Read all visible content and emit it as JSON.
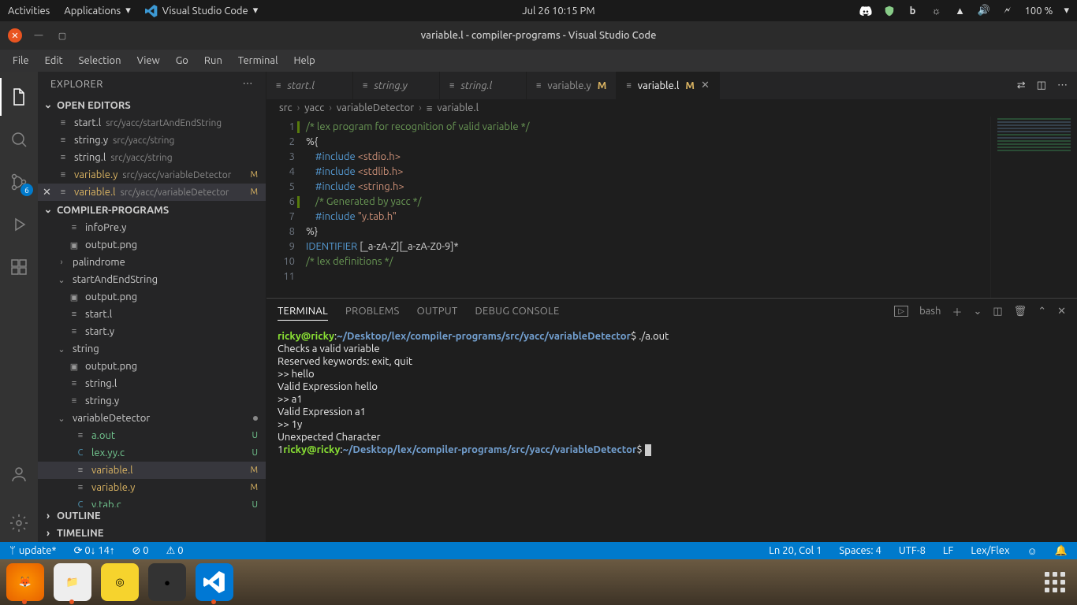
{
  "gnome": {
    "activities": "Activities",
    "applications": "Applications",
    "app_label": "Visual Studio Code",
    "datetime": "Jul 26  10:15 PM",
    "battery": "100 %"
  },
  "window": {
    "title": "variable.l - compiler-programs - Visual Studio Code"
  },
  "menubar": [
    "File",
    "Edit",
    "Selection",
    "View",
    "Go",
    "Run",
    "Terminal",
    "Help"
  ],
  "sidebar": {
    "title": "EXPLORER",
    "open_editors": "OPEN EDITORS",
    "project": "COMPILER-PROGRAMS",
    "outline": "OUTLINE",
    "timeline": "TIMELINE",
    "editors": [
      {
        "name": "start.l",
        "path": "src/yacc/startAndEndString",
        "mod": ""
      },
      {
        "name": "string.y",
        "path": "src/yacc/string",
        "mod": ""
      },
      {
        "name": "string.l",
        "path": "src/yacc/string",
        "mod": ""
      },
      {
        "name": "variable.y",
        "path": "src/yacc/variableDetector",
        "mod": "M"
      },
      {
        "name": "variable.l",
        "path": "src/yacc/variableDetector",
        "mod": "M",
        "active": true
      }
    ],
    "files": [
      {
        "name": "infoPre.y",
        "ind": 2,
        "ic": "≡"
      },
      {
        "name": "output.png",
        "ind": 2,
        "ic": "▣"
      },
      {
        "name": "palindrome",
        "ind": 1,
        "ic": "›",
        "folder": true
      },
      {
        "name": "startAndEndString",
        "ind": 1,
        "ic": "⌄",
        "folder": true
      },
      {
        "name": "output.png",
        "ind": 2,
        "ic": "▣"
      },
      {
        "name": "start.l",
        "ind": 2,
        "ic": "≡"
      },
      {
        "name": "start.y",
        "ind": 2,
        "ic": "≡"
      },
      {
        "name": "string",
        "ind": 1,
        "ic": "⌄",
        "folder": true
      },
      {
        "name": "output.png",
        "ind": 2,
        "ic": "▣"
      },
      {
        "name": "string.l",
        "ind": 2,
        "ic": "≡"
      },
      {
        "name": "string.y",
        "ind": 2,
        "ic": "≡"
      },
      {
        "name": "variableDetector",
        "ind": 1,
        "ic": "⌄",
        "folder": true,
        "dot": true
      },
      {
        "name": "a.out",
        "ind": 3,
        "ic": "≡",
        "cls": "green",
        "mod": "U"
      },
      {
        "name": "lex.yy.c",
        "ind": 3,
        "ic": "C",
        "cls": "green",
        "mod": "U"
      },
      {
        "name": "variable.l",
        "ind": 3,
        "ic": "≡",
        "cls": "amber",
        "mod": "M",
        "sel": true
      },
      {
        "name": "variable.y",
        "ind": 3,
        "ic": "≡",
        "cls": "amber",
        "mod": "M"
      },
      {
        "name": "y.tab.c",
        "ind": 3,
        "ic": "C",
        "cls": "green",
        "mod": "U"
      }
    ]
  },
  "scm_badge": "6",
  "tabs": [
    {
      "name": "start.l",
      "italic": true
    },
    {
      "name": "string.y",
      "italic": true
    },
    {
      "name": "string.l",
      "italic": true
    },
    {
      "name": "variable.y",
      "mod": "M"
    },
    {
      "name": "variable.l",
      "mod": "M",
      "active": true
    }
  ],
  "breadcrumb": [
    "src",
    "yacc",
    "variableDetector",
    "variable.l"
  ],
  "code": {
    "lines": [
      {
        "n": 1,
        "bar": true,
        "segs": [
          {
            "c": "cmt",
            "t": "/* lex program for recognition of valid variable */"
          }
        ]
      },
      {
        "n": 2,
        "segs": [
          {
            "c": "txt",
            "t": "%{"
          }
        ]
      },
      {
        "n": 3,
        "segs": [
          {
            "c": "txt",
            "t": "    "
          },
          {
            "c": "pp",
            "t": "#include "
          },
          {
            "c": "str",
            "t": "<stdio.h>"
          }
        ]
      },
      {
        "n": 4,
        "segs": [
          {
            "c": "txt",
            "t": "    "
          },
          {
            "c": "pp",
            "t": "#include "
          },
          {
            "c": "str",
            "t": "<stdlib.h>"
          }
        ]
      },
      {
        "n": 5,
        "segs": [
          {
            "c": "txt",
            "t": "    "
          },
          {
            "c": "pp",
            "t": "#include "
          },
          {
            "c": "str",
            "t": "<string.h>"
          }
        ]
      },
      {
        "n": 6,
        "bar": true,
        "segs": [
          {
            "c": "txt",
            "t": "    "
          },
          {
            "c": "cmt",
            "t": "/* Generated by yacc */"
          }
        ]
      },
      {
        "n": 7,
        "segs": [
          {
            "c": "txt",
            "t": "    "
          },
          {
            "c": "pp",
            "t": "#include "
          },
          {
            "c": "str",
            "t": "\"y.tab.h\""
          }
        ]
      },
      {
        "n": 8,
        "segs": [
          {
            "c": "txt",
            "t": "%}"
          }
        ]
      },
      {
        "n": 9,
        "segs": [
          {
            "c": "mac",
            "t": "IDENTIFIER"
          },
          {
            "c": "txt",
            "t": " [_a-zA-Z][_a-zA-Z0-9]*"
          }
        ]
      },
      {
        "n": 10,
        "segs": [
          {
            "c": "txt",
            "t": ""
          }
        ]
      },
      {
        "n": 11,
        "segs": [
          {
            "c": "cmt",
            "t": "/* lex definitions */"
          }
        ]
      }
    ]
  },
  "panel": {
    "tabs": [
      "TERMINAL",
      "PROBLEMS",
      "OUTPUT",
      "DEBUG CONSOLE"
    ],
    "shell": "bash",
    "term": {
      "user": "ricky@ricky",
      "cwd": "~/Desktop/lex/compiler-programs/src/yacc/variableDetector",
      "cmd1": "./a.out",
      "l1": "Checks a valid variable",
      "l2": "Reserved keywords: exit, quit",
      "l3": ">> hello",
      "l4": "Valid Expression hello",
      "l5": ">> a1",
      "l6": "Valid Expression a1",
      "l7": ">> 1y",
      "l8": "Unexpected Character",
      "pfx": "1"
    }
  },
  "status": {
    "branch": "update*",
    "sync": "⟳ 0↓ 14↑",
    "errs": "⊘ 0",
    "warns": "⚠ 0",
    "pos": "Ln 20, Col 1",
    "spaces": "Spaces: 4",
    "enc": "UTF-8",
    "eol": "LF",
    "lang": "Lex/Flex"
  }
}
